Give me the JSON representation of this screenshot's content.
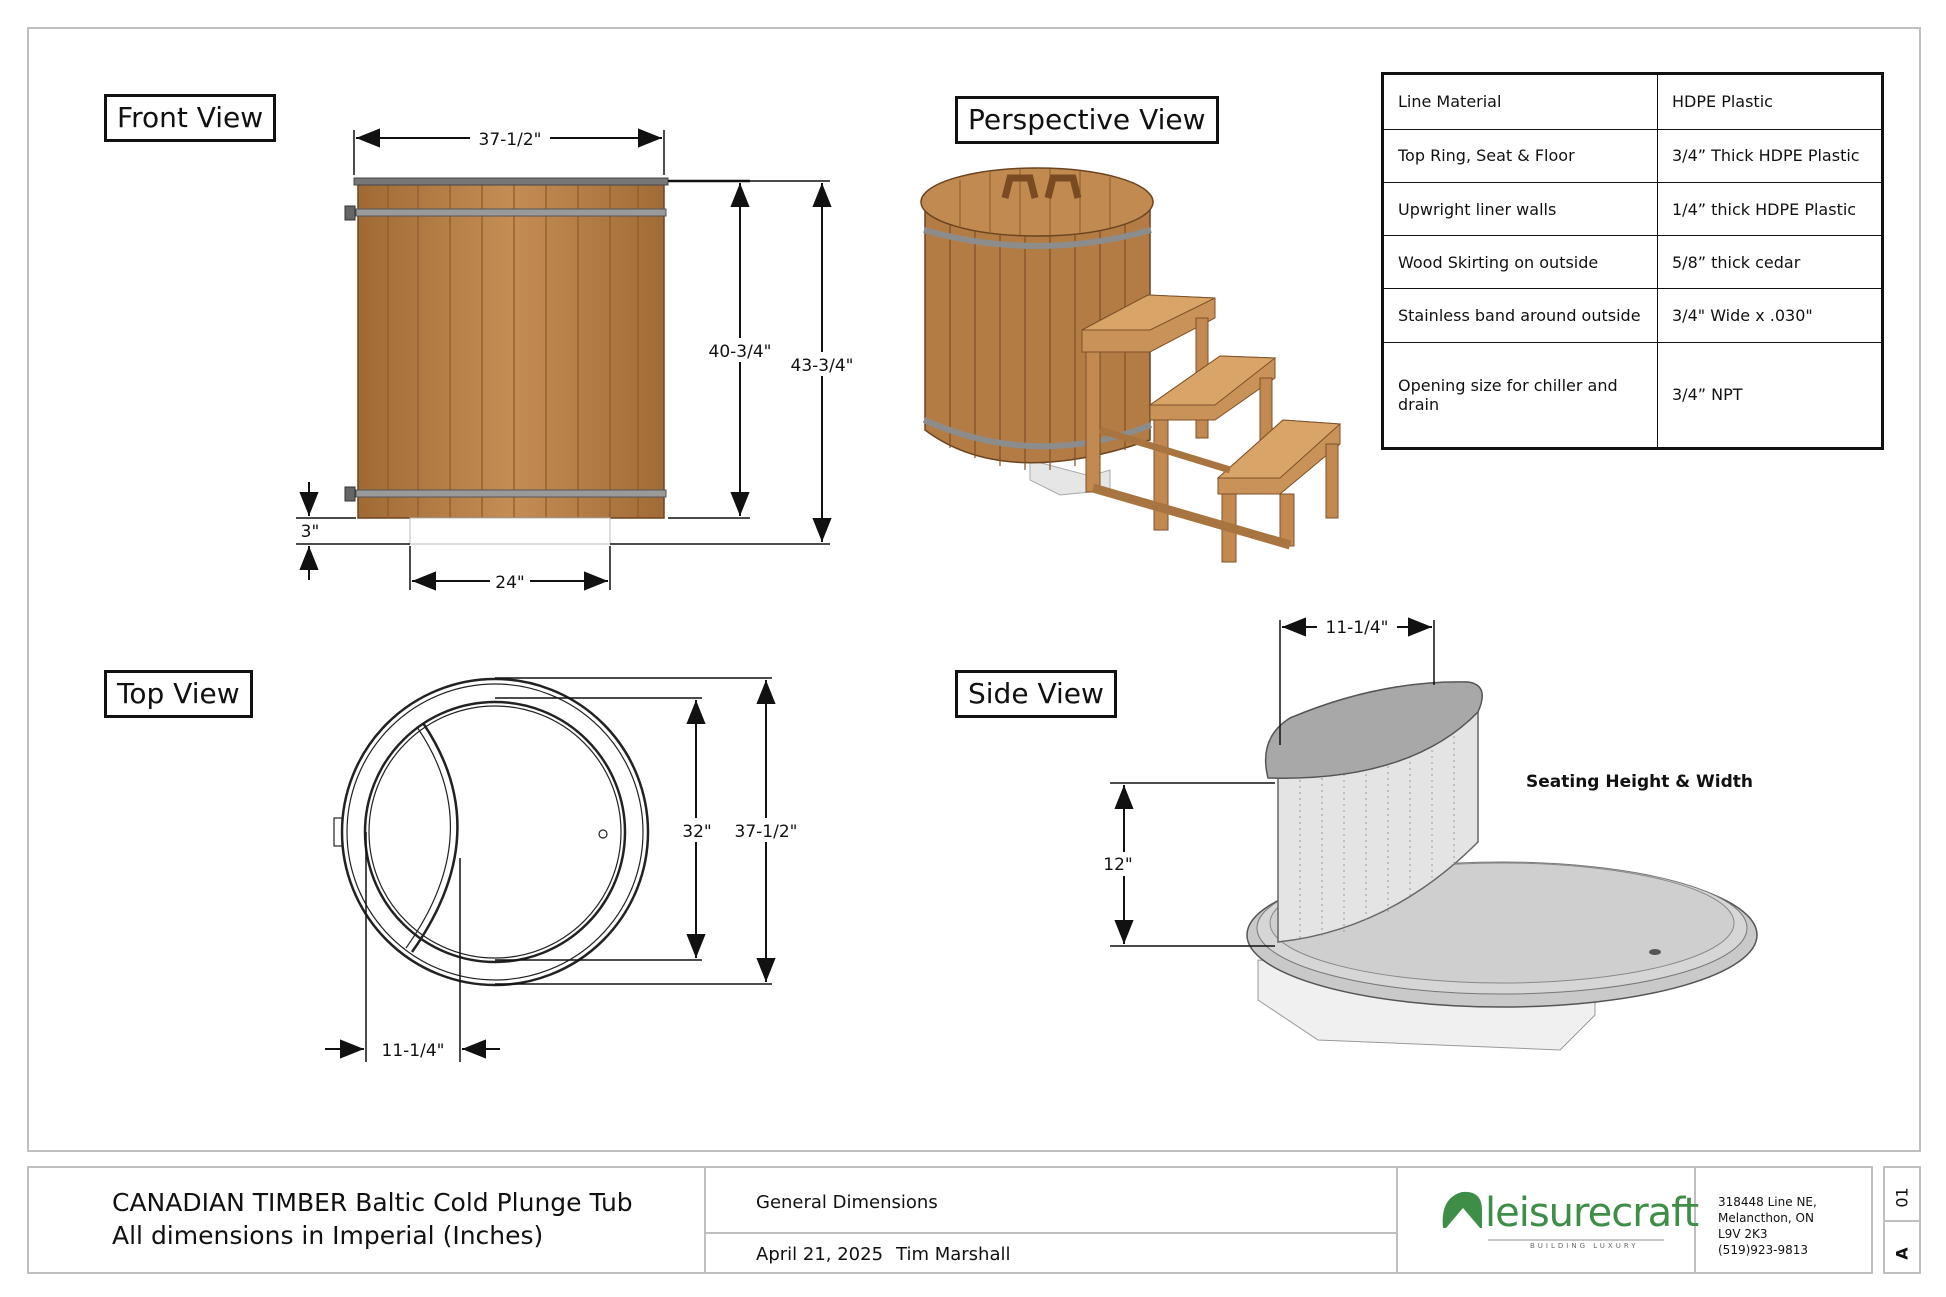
{
  "views": {
    "front": "Front View",
    "perspective": "Perspective View",
    "top": "Top View",
    "side": "Side View"
  },
  "specs": [
    {
      "label": "Line Material",
      "value": "HDPE Plastic"
    },
    {
      "label": "Top Ring, Seat & Floor",
      "value": "3/4” Thick HDPE Plastic"
    },
    {
      "label": "Upwright liner walls",
      "value": "1/4” thick HDPE Plastic"
    },
    {
      "label": "Wood Skirting on outside",
      "value": "5/8” thick cedar"
    },
    {
      "label": "Stainless band around outside",
      "value": "3/4\" Wide x .030\""
    },
    {
      "label": "Opening size for chiller and drain",
      "value": "3/4” NPT"
    }
  ],
  "dims": {
    "front_width": "37-1/2\"",
    "front_body_height": "40-3/4\"",
    "front_total_height": "43-3/4\"",
    "front_base_height": "3\"",
    "front_base_width": "24\"",
    "top_inner": "32\"",
    "top_outer": "37-1/2\"",
    "top_seat": "11-1/4\"",
    "side_seat_width": "11-1/4\"",
    "side_seat_height": "12\""
  },
  "side_note": "Seating Height & Width",
  "title_block": {
    "line1": "CANADIAN TIMBER Baltic Cold Plunge Tub",
    "line2": "All dimensions in Imperial (Inches)",
    "sheet": "General Dimensions",
    "date": "April 21, 2025",
    "author": "Tim Marshall",
    "logo": "leisurecraft",
    "tagline": "BUILDING LUXURY",
    "address": [
      "318448 Line NE,",
      "Melancthon, ON",
      "L9V 2K3",
      "(519)923-9813"
    ],
    "sheet_no": "01",
    "revision": "A"
  },
  "colors": {
    "cedar": "#b8824a",
    "cedar_dark": "#8a5a2b",
    "band": "#8c8c8c",
    "liner": "#d9d9d9",
    "logo_green": "#3f8e47"
  }
}
